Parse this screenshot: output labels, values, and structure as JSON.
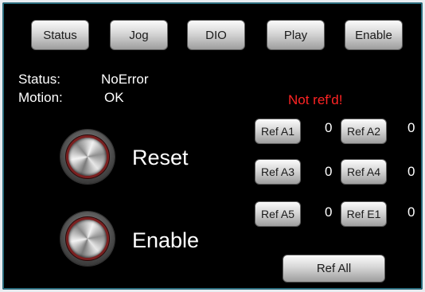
{
  "tabs": [
    "Status",
    "Jog",
    "DIO",
    "Play",
    "Enable"
  ],
  "status": {
    "status_label": "Status:",
    "status_value": "NoError",
    "motion_label": "Motion:",
    "motion_value": "OK"
  },
  "warning": "Not ref'd!",
  "controls": {
    "reset_label": "Reset",
    "enable_label": "Enable"
  },
  "refs": [
    {
      "label": "Ref A1",
      "value": "0"
    },
    {
      "label": "Ref A2",
      "value": "0"
    },
    {
      "label": "Ref A3",
      "value": "0"
    },
    {
      "label": "Ref A4",
      "value": "0"
    },
    {
      "label": "Ref A5",
      "value": "0"
    },
    {
      "label": "Ref E1",
      "value": "0"
    }
  ],
  "ref_all_label": "Ref All",
  "colors": {
    "background": "#000000",
    "warning": "#ff2424",
    "text": "#ffffff",
    "knob_ring": "#7a2020"
  }
}
